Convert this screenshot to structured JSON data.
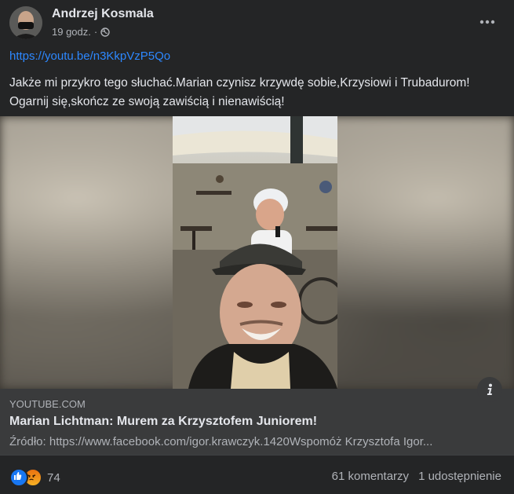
{
  "post": {
    "author": "Andrzej Kosmala",
    "time": "19 godz.",
    "separator": "·",
    "privacy_icon": "globe-icon",
    "more_icon": "more-options-icon",
    "link_text": "https://youtu.be/n3KkpVzP5Qo",
    "text": "Jakże mi przykro tego słuchać.Marian czynisz krzywdę sobie,Krzysiowi i Trubadurom! Ogarnij się,skończ ze swoją zawiścią i nienawiścią!"
  },
  "link_preview": {
    "domain": "YOUTUBE.COM",
    "title": "Marian Lichtman: Murem za Krzysztofem Juniorem!",
    "description": "Źródło: https://www.facebook.com/igor.krawczyk.1420Wspomóż Krzysztofa Igor...",
    "info_icon": "info-icon"
  },
  "stats": {
    "reactions": [
      "like-icon",
      "angry-icon"
    ],
    "reaction_count": "74",
    "comments": "61 komentarzy",
    "shares": "1 udostępnienie"
  },
  "colors": {
    "background": "#242526",
    "link": "#2d88ff",
    "primary_text": "#e4e6eb",
    "secondary_text": "#b0b3b8",
    "preview_bg": "#3a3b3c",
    "like": "#1877f2"
  }
}
